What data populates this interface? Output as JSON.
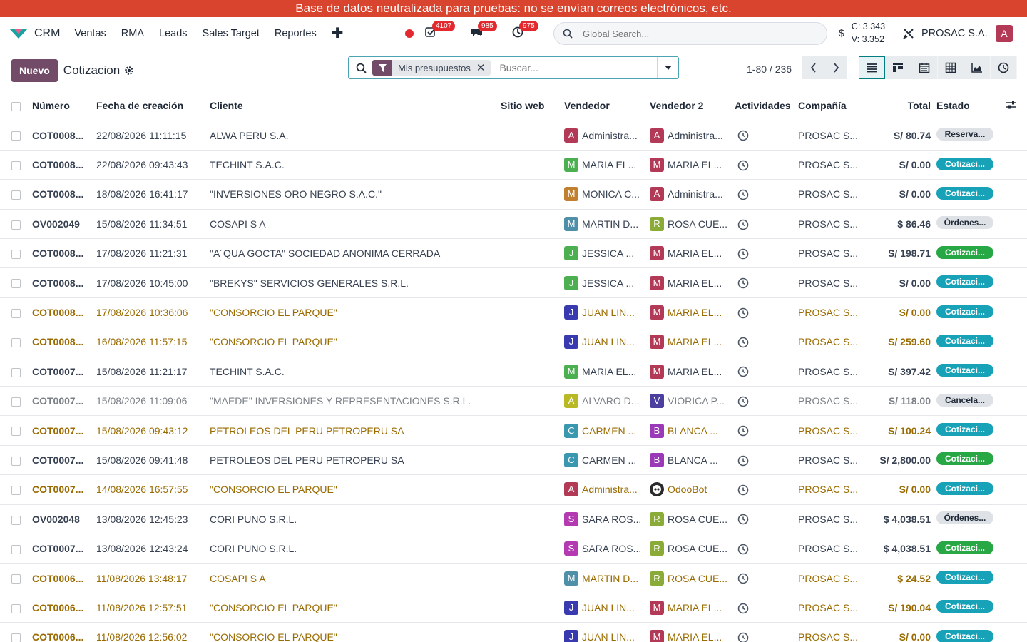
{
  "banner": "Base de datos neutralizada para pruebas: no se envían correos electrónicos, etc.",
  "nav": {
    "app_name": "CRM",
    "menu": [
      "Ventas",
      "RMA",
      "Leads",
      "Sales Target",
      "Reportes"
    ],
    "activities_count": "4107",
    "messages_count": "985",
    "timer_count": "975",
    "global_search_placeholder": "Global Search...",
    "currency_symbol": "$",
    "rate_buy": "C: 3.343",
    "rate_sell": "V: 3.352",
    "company": "PROSAC S.A.",
    "user_initial": "A"
  },
  "control": {
    "new_label": "Nuevo",
    "title": "Cotizacion",
    "facet": "Mis presupuestos",
    "search_placeholder": "Buscar...",
    "pager": "1-80 / 236"
  },
  "columns": {
    "numero": "Número",
    "fecha": "Fecha de creación",
    "cliente": "Cliente",
    "sitio": "Sitio web",
    "vendedor": "Vendedor",
    "vendedor2": "Vendedor 2",
    "actividades": "Actividades",
    "compania": "Compañía",
    "total": "Total",
    "estado": "Estado"
  },
  "colors": {
    "brand": "#714b67",
    "banner": "#d9442f",
    "warning_text": "#9a6b00",
    "badge_info": "#17a2b8",
    "badge_success": "#28a745"
  },
  "rows": [
    {
      "numero": "COT0008...",
      "fecha": "22/08/2026 11:11:15",
      "cliente": "ALWA PERU S.A.",
      "v1i": "A",
      "v1c": "#b33a57",
      "v1": "Administra...",
      "v2i": "A",
      "v2c": "#b33a57",
      "v2": "Administra...",
      "compania": "PROSAC S...",
      "total": "S/ 80.74",
      "estado": "Reserva...",
      "st": "muted",
      "tone": ""
    },
    {
      "numero": "COT0008...",
      "fecha": "22/08/2026 09:43:43",
      "cliente": "TECHINT S.A.C.",
      "v1i": "M",
      "v1c": "#4caf50",
      "v1": "MARIA EL...",
      "v2i": "M",
      "v2c": "#b33a57",
      "v2": "MARIA EL...",
      "compania": "PROSAC S...",
      "total": "S/ 0.00",
      "estado": "Cotizaci...",
      "st": "info",
      "tone": ""
    },
    {
      "numero": "COT0008...",
      "fecha": "18/08/2026 16:41:17",
      "cliente": "\"INVERSIONES ORO NEGRO S.A.C.\"",
      "v1i": "M",
      "v1c": "#c1802f",
      "v1": "MONICA C...",
      "v2i": "A",
      "v2c": "#b33a57",
      "v2": "Administra...",
      "compania": "PROSAC S...",
      "total": "S/ 0.00",
      "estado": "Cotizaci...",
      "st": "info",
      "tone": ""
    },
    {
      "numero": "OV002049",
      "fecha": "15/08/2026 11:34:51",
      "cliente": "COSAPI S A",
      "v1i": "M",
      "v1c": "#4f8fa8",
      "v1": "MARTIN D...",
      "v2i": "R",
      "v2c": "#8bab38",
      "v2": "ROSA CUE...",
      "compania": "PROSAC S...",
      "total": "$ 86.46",
      "estado": "Órdenes...",
      "st": "muted",
      "tone": ""
    },
    {
      "numero": "COT0008...",
      "fecha": "17/08/2026 11:21:31",
      "cliente": "\"A´QUA GOCTA\" SOCIEDAD ANONIMA CERRADA",
      "v1i": "J",
      "v1c": "#4caf50",
      "v1": "JESSICA ...",
      "v2i": "M",
      "v2c": "#b33a57",
      "v2": "MARIA EL...",
      "compania": "PROSAC S...",
      "total": "S/ 198.71",
      "estado": "Cotizaci...",
      "st": "success",
      "tone": ""
    },
    {
      "numero": "COT0008...",
      "fecha": "17/08/2026 10:45:00",
      "cliente": "\"BREKYS\" SERVICIOS GENERALES S.R.L.",
      "v1i": "J",
      "v1c": "#4caf50",
      "v1": "JESSICA ...",
      "v2i": "M",
      "v2c": "#b33a57",
      "v2": "MARIA EL...",
      "compania": "PROSAC S...",
      "total": "S/ 0.00",
      "estado": "Cotizaci...",
      "st": "info",
      "tone": ""
    },
    {
      "numero": "COT0008...",
      "fecha": "17/08/2026 10:36:06",
      "cliente": "\"CONSORCIO EL PARQUE\"",
      "v1i": "J",
      "v1c": "#3a3ab0",
      "v1": "JUAN LIN...",
      "v2i": "M",
      "v2c": "#b33a57",
      "v2": "MARIA EL...",
      "compania": "PROSAC S...",
      "total": "S/ 0.00",
      "estado": "Cotizaci...",
      "st": "info",
      "tone": "warn"
    },
    {
      "numero": "COT0008...",
      "fecha": "16/08/2026 11:57:15",
      "cliente": "\"CONSORCIO EL PARQUE\"",
      "v1i": "J",
      "v1c": "#3a3ab0",
      "v1": "JUAN LIN...",
      "v2i": "M",
      "v2c": "#b33a57",
      "v2": "MARIA EL...",
      "compania": "PROSAC S...",
      "total": "S/ 259.60",
      "estado": "Cotizaci...",
      "st": "info",
      "tone": "warn"
    },
    {
      "numero": "COT0007...",
      "fecha": "15/08/2026 11:21:17",
      "cliente": "TECHINT S.A.C.",
      "v1i": "M",
      "v1c": "#4caf50",
      "v1": "MARIA EL...",
      "v2i": "M",
      "v2c": "#b33a57",
      "v2": "MARIA EL...",
      "compania": "PROSAC S...",
      "total": "S/ 397.42",
      "estado": "Cotizaci...",
      "st": "info",
      "tone": ""
    },
    {
      "numero": "COT0007...",
      "fecha": "15/08/2026 11:09:06",
      "cliente": "\"MAEDE\" INVERSIONES Y REPRESENTACIONES S.R.L.",
      "v1i": "A",
      "v1c": "#b9b925",
      "v1": "ALVARO D...",
      "v2i": "V",
      "v2c": "#4b3fa0",
      "v2": "VIORICA P...",
      "compania": "PROSAC S...",
      "total": "S/ 118.00",
      "estado": "Cancela...",
      "st": "muted",
      "tone": "muted"
    },
    {
      "numero": "COT0007...",
      "fecha": "15/08/2026 09:43:12",
      "cliente": "PETROLEOS DEL PERU PETROPERU SA",
      "v1i": "C",
      "v1c": "#3a97b0",
      "v1": "CARMEN ...",
      "v2i": "B",
      "v2c": "#9b3ab8",
      "v2": "BLANCA ...",
      "compania": "PROSAC S...",
      "total": "S/ 100.24",
      "estado": "Cotizaci...",
      "st": "info",
      "tone": "warn"
    },
    {
      "numero": "COT0007...",
      "fecha": "15/08/2026 09:41:48",
      "cliente": "PETROLEOS DEL PERU PETROPERU SA",
      "v1i": "C",
      "v1c": "#3a97b0",
      "v1": "CARMEN ...",
      "v2i": "B",
      "v2c": "#9b3ab8",
      "v2": "BLANCA ...",
      "compania": "PROSAC S...",
      "total": "S/ 2,800.00",
      "estado": "Cotizaci...",
      "st": "success",
      "tone": ""
    },
    {
      "numero": "COT0007...",
      "fecha": "14/08/2026 16:57:55",
      "cliente": "\"CONSORCIO EL PARQUE\"",
      "v1i": "A",
      "v1c": "#b33a57",
      "v1": "Administra...",
      "v2i": "",
      "v2c": "#2b2b2b",
      "v2": "OdooBot",
      "compania": "PROSAC S...",
      "total": "S/ 0.00",
      "estado": "Cotizaci...",
      "st": "info",
      "tone": "warn"
    },
    {
      "numero": "OV002048",
      "fecha": "13/08/2026 12:45:23",
      "cliente": "CORI PUNO S.R.L.",
      "v1i": "S",
      "v1c": "#b33ab0",
      "v1": "SARA ROS...",
      "v2i": "R",
      "v2c": "#8bab38",
      "v2": "ROSA CUE...",
      "compania": "PROSAC S...",
      "total": "$ 4,038.51",
      "estado": "Órdenes...",
      "st": "muted",
      "tone": ""
    },
    {
      "numero": "COT0007...",
      "fecha": "13/08/2026 12:43:24",
      "cliente": "CORI PUNO S.R.L.",
      "v1i": "S",
      "v1c": "#b33ab0",
      "v1": "SARA ROS...",
      "v2i": "R",
      "v2c": "#8bab38",
      "v2": "ROSA CUE...",
      "compania": "PROSAC S...",
      "total": "$ 4,038.51",
      "estado": "Cotizaci...",
      "st": "success",
      "tone": ""
    },
    {
      "numero": "COT0006...",
      "fecha": "11/08/2026 13:48:17",
      "cliente": "COSAPI S A",
      "v1i": "M",
      "v1c": "#4f8fa8",
      "v1": "MARTIN D...",
      "v2i": "R",
      "v2c": "#8bab38",
      "v2": "ROSA CUE...",
      "compania": "PROSAC S...",
      "total": "$ 24.52",
      "estado": "Cotizaci...",
      "st": "info",
      "tone": "warn"
    },
    {
      "numero": "COT0006...",
      "fecha": "11/08/2026 12:57:51",
      "cliente": "\"CONSORCIO EL PARQUE\"",
      "v1i": "J",
      "v1c": "#3a3ab0",
      "v1": "JUAN LIN...",
      "v2i": "M",
      "v2c": "#b33a57",
      "v2": "MARIA EL...",
      "compania": "PROSAC S...",
      "total": "S/ 190.04",
      "estado": "Cotizaci...",
      "st": "info",
      "tone": "warn"
    },
    {
      "numero": "COT0006...",
      "fecha": "11/08/2026 12:56:02",
      "cliente": "\"CONSORCIO EL PARQUE\"",
      "v1i": "J",
      "v1c": "#3a3ab0",
      "v1": "JUAN LIN...",
      "v2i": "M",
      "v2c": "#b33a57",
      "v2": "MARIA EL...",
      "compania": "PROSAC S...",
      "total": "S/ 0.00",
      "estado": "Cotizaci...",
      "st": "info",
      "tone": "warn"
    }
  ]
}
